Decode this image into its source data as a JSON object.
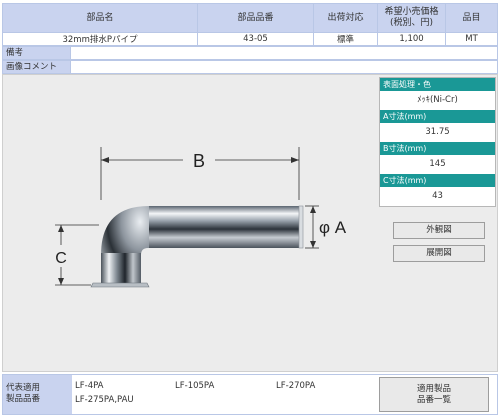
{
  "header": {
    "col_name": "部品名",
    "col_number": "部品品番",
    "col_shipping": "出荷対応",
    "col_price_line1": "希望小売価格",
    "col_price_line2": "(税別、円)",
    "col_category": "品目",
    "name": "32mm排水Pパイプ",
    "number": "43-05",
    "shipping": "標準",
    "price": "1,100",
    "category": "MT"
  },
  "notes": {
    "label": "備考",
    "value": ""
  },
  "image_comment": {
    "label": "画像コメント",
    "value": ""
  },
  "drawing": {
    "label_b": "B",
    "label_a": "φ A",
    "label_c": "C"
  },
  "specs": [
    {
      "title": "表面処理・色",
      "value": "ﾒｯｷ(Ni-Cr)"
    },
    {
      "title": "A寸法(mm)",
      "value": "31.75"
    },
    {
      "title": "B寸法(mm)",
      "value": "145"
    },
    {
      "title": "C寸法(mm)",
      "value": "43"
    }
  ],
  "buttons": {
    "exterior": "外観図",
    "development": "展開図",
    "applicable_list_line1": "適用製品",
    "applicable_list_line2": "品番一覧"
  },
  "applicable": {
    "label_line1": "代表適用",
    "label_line2": "製品品番",
    "codes": [
      "LF-4PA",
      "LF-105PA",
      "LF-270PA",
      "LF-275PA,PAU"
    ]
  },
  "colors": {
    "header_bg": "#c9d3ef",
    "spec_title_bg": "#1a9896",
    "panel_bg": "#ececec"
  }
}
